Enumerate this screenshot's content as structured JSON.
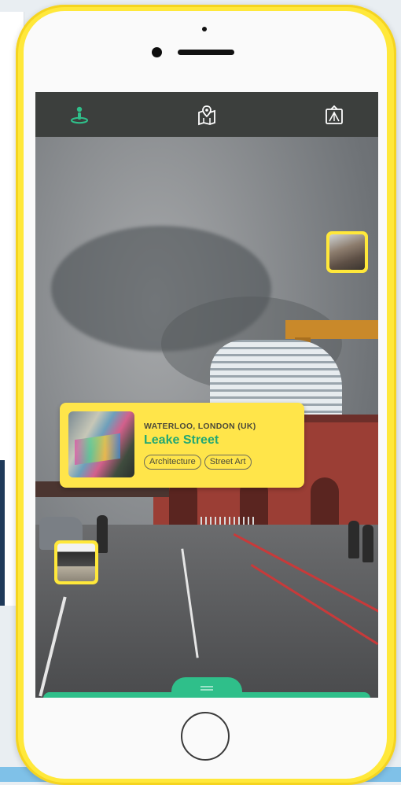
{
  "app": {
    "nav_tabs": [
      {
        "icon": "person-pin-icon",
        "active": true
      },
      {
        "icon": "map-pin-icon",
        "active": false
      },
      {
        "icon": "ar-view-icon",
        "active": false
      }
    ]
  },
  "info_card": {
    "location": "WATERLOO, LONDON (UK)",
    "title": "Leake Street",
    "tags": [
      "Architecture",
      "Street Art"
    ]
  },
  "colors": {
    "phone_frame": "#ffe83a",
    "accent_green": "#2fbf8a",
    "title_green": "#22a873",
    "topbar_bg": "#3c3f3d"
  }
}
